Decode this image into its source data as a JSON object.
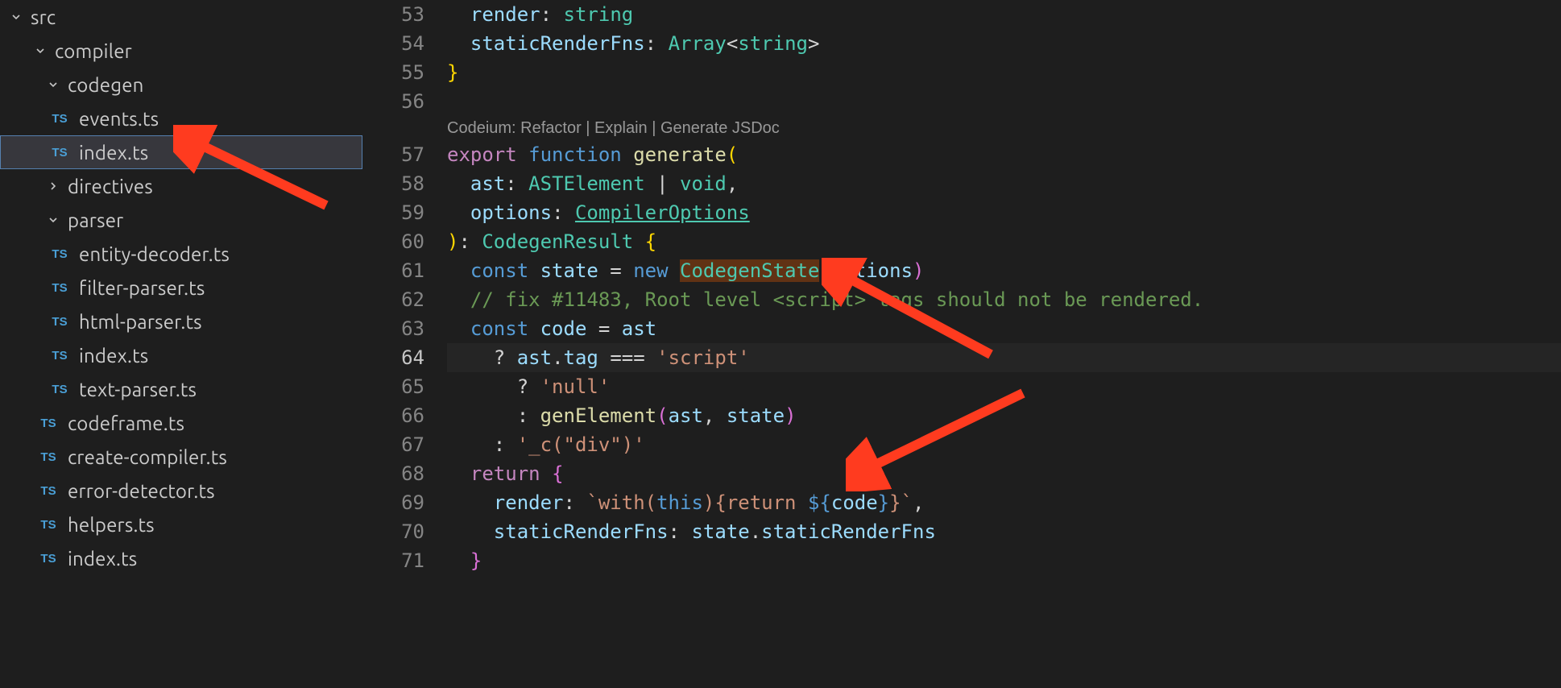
{
  "sidebar": {
    "items": [
      {
        "type": "folder",
        "name": "src",
        "indent": 0,
        "open": true
      },
      {
        "type": "folder",
        "name": "compiler",
        "indent": 1,
        "open": true
      },
      {
        "type": "folder",
        "name": "codegen",
        "indent": 2,
        "open": true
      },
      {
        "type": "file",
        "name": "events.ts",
        "indent": 3,
        "icon": "TS"
      },
      {
        "type": "file",
        "name": "index.ts",
        "indent": 3,
        "icon": "TS",
        "selected": true
      },
      {
        "type": "folder",
        "name": "directives",
        "indent": 2,
        "open": false
      },
      {
        "type": "folder",
        "name": "parser",
        "indent": 2,
        "open": true
      },
      {
        "type": "file",
        "name": "entity-decoder.ts",
        "indent": 3,
        "icon": "TS"
      },
      {
        "type": "file",
        "name": "filter-parser.ts",
        "indent": 3,
        "icon": "TS"
      },
      {
        "type": "file",
        "name": "html-parser.ts",
        "indent": 3,
        "icon": "TS"
      },
      {
        "type": "file",
        "name": "index.ts",
        "indent": 3,
        "icon": "TS"
      },
      {
        "type": "file",
        "name": "text-parser.ts",
        "indent": 3,
        "icon": "TS"
      },
      {
        "type": "file",
        "name": "codeframe.ts",
        "indent": 2,
        "icon": "TS"
      },
      {
        "type": "file",
        "name": "create-compiler.ts",
        "indent": 2,
        "icon": "TS"
      },
      {
        "type": "file",
        "name": "error-detector.ts",
        "indent": 2,
        "icon": "TS"
      },
      {
        "type": "file",
        "name": "helpers.ts",
        "indent": 2,
        "icon": "TS"
      },
      {
        "type": "file",
        "name": "index.ts",
        "indent": 2,
        "icon": "TS"
      }
    ]
  },
  "gutter": {
    "start": 53,
    "end": 71,
    "current": 64,
    "codelens_after": 56
  },
  "codelens": {
    "items": [
      "Codeium: Refactor",
      "Explain",
      "Generate JSDoc"
    ],
    "sep": " | "
  },
  "code": {
    "l53": {
      "render": "render",
      "colon": ": ",
      "string": "string"
    },
    "l54": {
      "staticRenderFns": "staticRenderFns",
      "colon": ": ",
      "Array": "Array",
      "lt": "<",
      "string": "string",
      "gt": ">"
    },
    "l55": {
      "brace": "}"
    },
    "l57": {
      "export": "export",
      "function": "function",
      "generate": "generate",
      "p": "("
    },
    "l58": {
      "ast": "ast",
      "colon": ": ",
      "ASTElement": "ASTElement",
      "pipe": " | ",
      "void": "void",
      "comma": ","
    },
    "l59": {
      "options": "options",
      "colon": ": ",
      "CompilerOptions": "CompilerOptions"
    },
    "l60": {
      "p": ")",
      "colon": ": ",
      "CodegenResult": "CodegenResult",
      "brace": "{"
    },
    "l61": {
      "const": "const",
      "state": "state",
      "eq": " = ",
      "new": "new",
      "CodegenState": "CodegenState",
      "p1": "(",
      "options": "options",
      "p2": ")"
    },
    "l62": {
      "comment": "// fix #11483, Root level <script> tags should not be rendered."
    },
    "l63": {
      "const": "const",
      "code": "code",
      "eq": " = ",
      "ast": "ast"
    },
    "l64": {
      "q": "? ",
      "ast": "ast",
      "dot": ".",
      "tag": "tag",
      "eq": " === ",
      "str": "'script'"
    },
    "l65": {
      "q": "? ",
      "str": "'null'"
    },
    "l66": {
      "colon": ": ",
      "genElement": "genElement",
      "p1": "(",
      "ast": "ast",
      "comma": ", ",
      "state": "state",
      "p2": ")"
    },
    "l67": {
      "colon": ": ",
      "str": "'_c(\"div\")'"
    },
    "l68": {
      "return": "return",
      "brace": "{"
    },
    "l69": {
      "render": "render",
      "colon": ": ",
      "bt1": "`",
      "with": "with(",
      "this": "this",
      "paren": ")",
      "brace1": "{",
      "return": "return ",
      "dollar": "${",
      "code": "code",
      "brace2": "}",
      "brace3": "}",
      "bt2": "`",
      "comma": ","
    },
    "l70": {
      "staticRenderFns": "staticRenderFns",
      "colon": ": ",
      "state": "state",
      "dot": ".",
      "prop": "staticRenderFns"
    },
    "l71": {
      "brace": "}"
    }
  }
}
